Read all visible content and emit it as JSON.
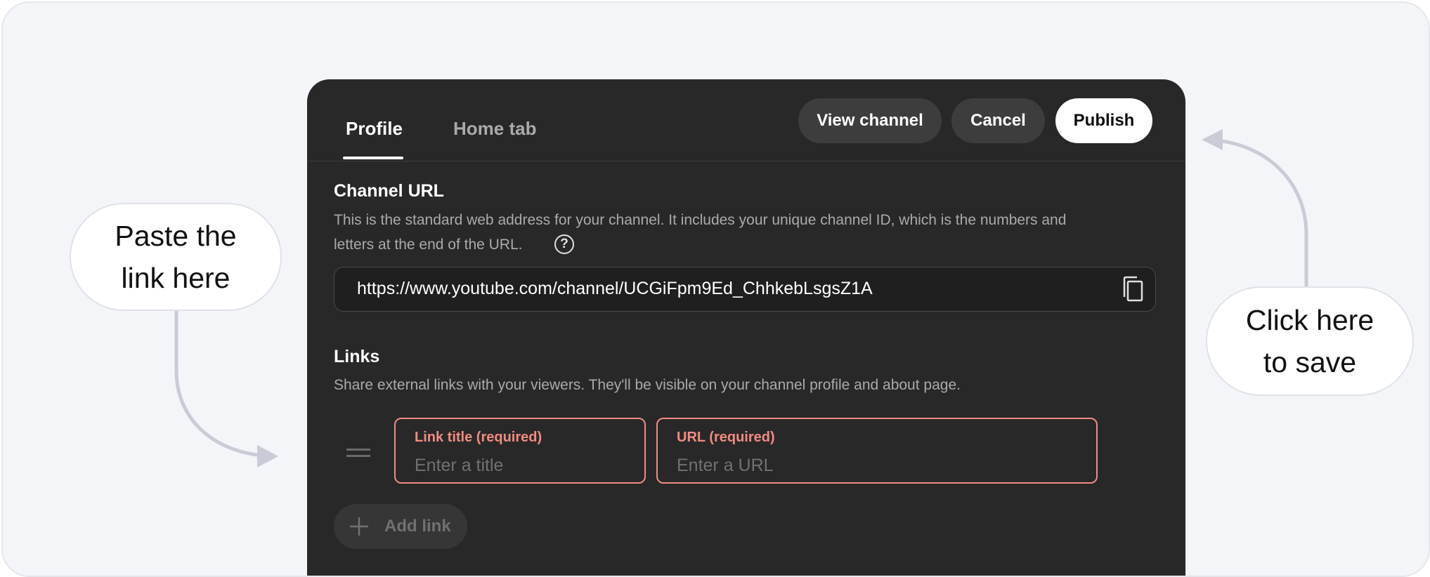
{
  "tabs": [
    {
      "label": "Profile",
      "active": true
    },
    {
      "label": "Home tab",
      "active": false
    }
  ],
  "header_buttons": {
    "view_channel": "View channel",
    "cancel": "Cancel",
    "publish": "Publish"
  },
  "channel_url": {
    "title": "Channel URL",
    "description_line1": "This is the standard web address for your channel. It includes your unique channel ID, which is the numbers and",
    "description_line2": "letters at the end of the URL.",
    "help_icon": "?",
    "value": "https://www.youtube.com/channel/UCGiFpm9Ed_ChhkebLsgsZ1A",
    "copy_icon": "copy-icon"
  },
  "links": {
    "title": "Links",
    "description": "Share external links with your viewers. They'll be visible on your channel profile and about page.",
    "title_field": {
      "label": "Link title (required)",
      "placeholder": "Enter a title",
      "value": ""
    },
    "url_field": {
      "label": "URL (required)",
      "placeholder": "Enter a URL",
      "value": ""
    },
    "add_link_label": "Add link"
  },
  "annotations": {
    "left_line1": "Paste the",
    "left_line2": "link here",
    "right_line1": "Click here",
    "right_line2": "to save"
  },
  "colors": {
    "panel": "#282828",
    "error": "#f28b82",
    "background": "#f4f5f9",
    "arrow": "#c9ccd6"
  }
}
